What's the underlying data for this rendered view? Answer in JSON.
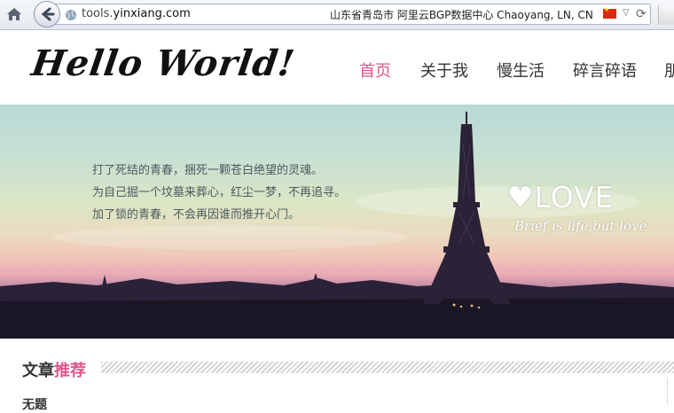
{
  "browser": {
    "url_prefix": "tools.",
    "url_domain": "yinxiang.com",
    "location": "山东省青岛市 阿里云BGP数据中心   Chaoyang, LN, CN"
  },
  "site": {
    "logo": "Hello World!",
    "nav": [
      "首页",
      "关于我",
      "慢生活",
      "碎言碎语",
      "朋"
    ]
  },
  "banner": {
    "quotes": [
      "打了死结的青春，捆死一颗苍白绝望的灵魂。",
      "为自己掘一个坟墓来葬心，红尘一梦，不再追寻。",
      "加了锁的青春，不会再因谁而推开心门。"
    ],
    "love_title": "♥LOVE",
    "love_sub": "Brief is life,but love"
  },
  "section": {
    "title_plain": "文章",
    "title_highlight": "推荐",
    "row_title": "无题"
  },
  "colors": {
    "accent": "#e0558a",
    "nav_text": "#333333"
  }
}
